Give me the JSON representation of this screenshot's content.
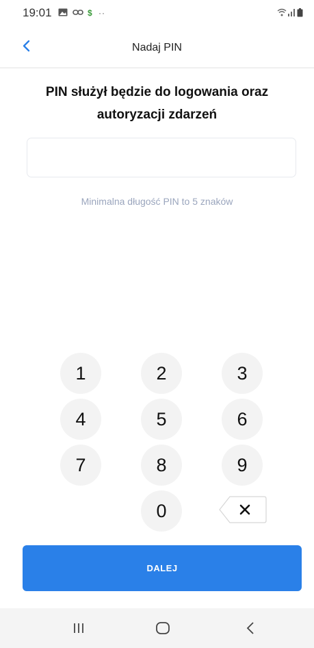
{
  "status_bar": {
    "time": "19:01",
    "icons": [
      "gallery-icon",
      "link-icon",
      "dollar-icon",
      "more-dots-icon",
      "wifi-icon",
      "signal-icon",
      "battery-icon"
    ]
  },
  "header": {
    "title": "Nadaj PIN",
    "back_icon": "chevron-left-icon"
  },
  "main": {
    "prompt": "PIN służył będzie do logowania oraz autoryzacji zdarzeń",
    "pin_value": "",
    "hint": "Minimalna długość PIN to 5 znaków"
  },
  "keypad": {
    "keys": [
      "1",
      "2",
      "3",
      "4",
      "5",
      "6",
      "7",
      "8",
      "9",
      "0"
    ],
    "backspace_icon": "backspace-icon"
  },
  "actions": {
    "next_label": "DALEJ"
  },
  "nav_bar": {
    "items": [
      "recent-apps-icon",
      "home-icon",
      "back-icon"
    ]
  },
  "colors": {
    "accent": "#2a80e8",
    "hint": "#9aa5bd",
    "key_bg": "#f3f3f3"
  }
}
